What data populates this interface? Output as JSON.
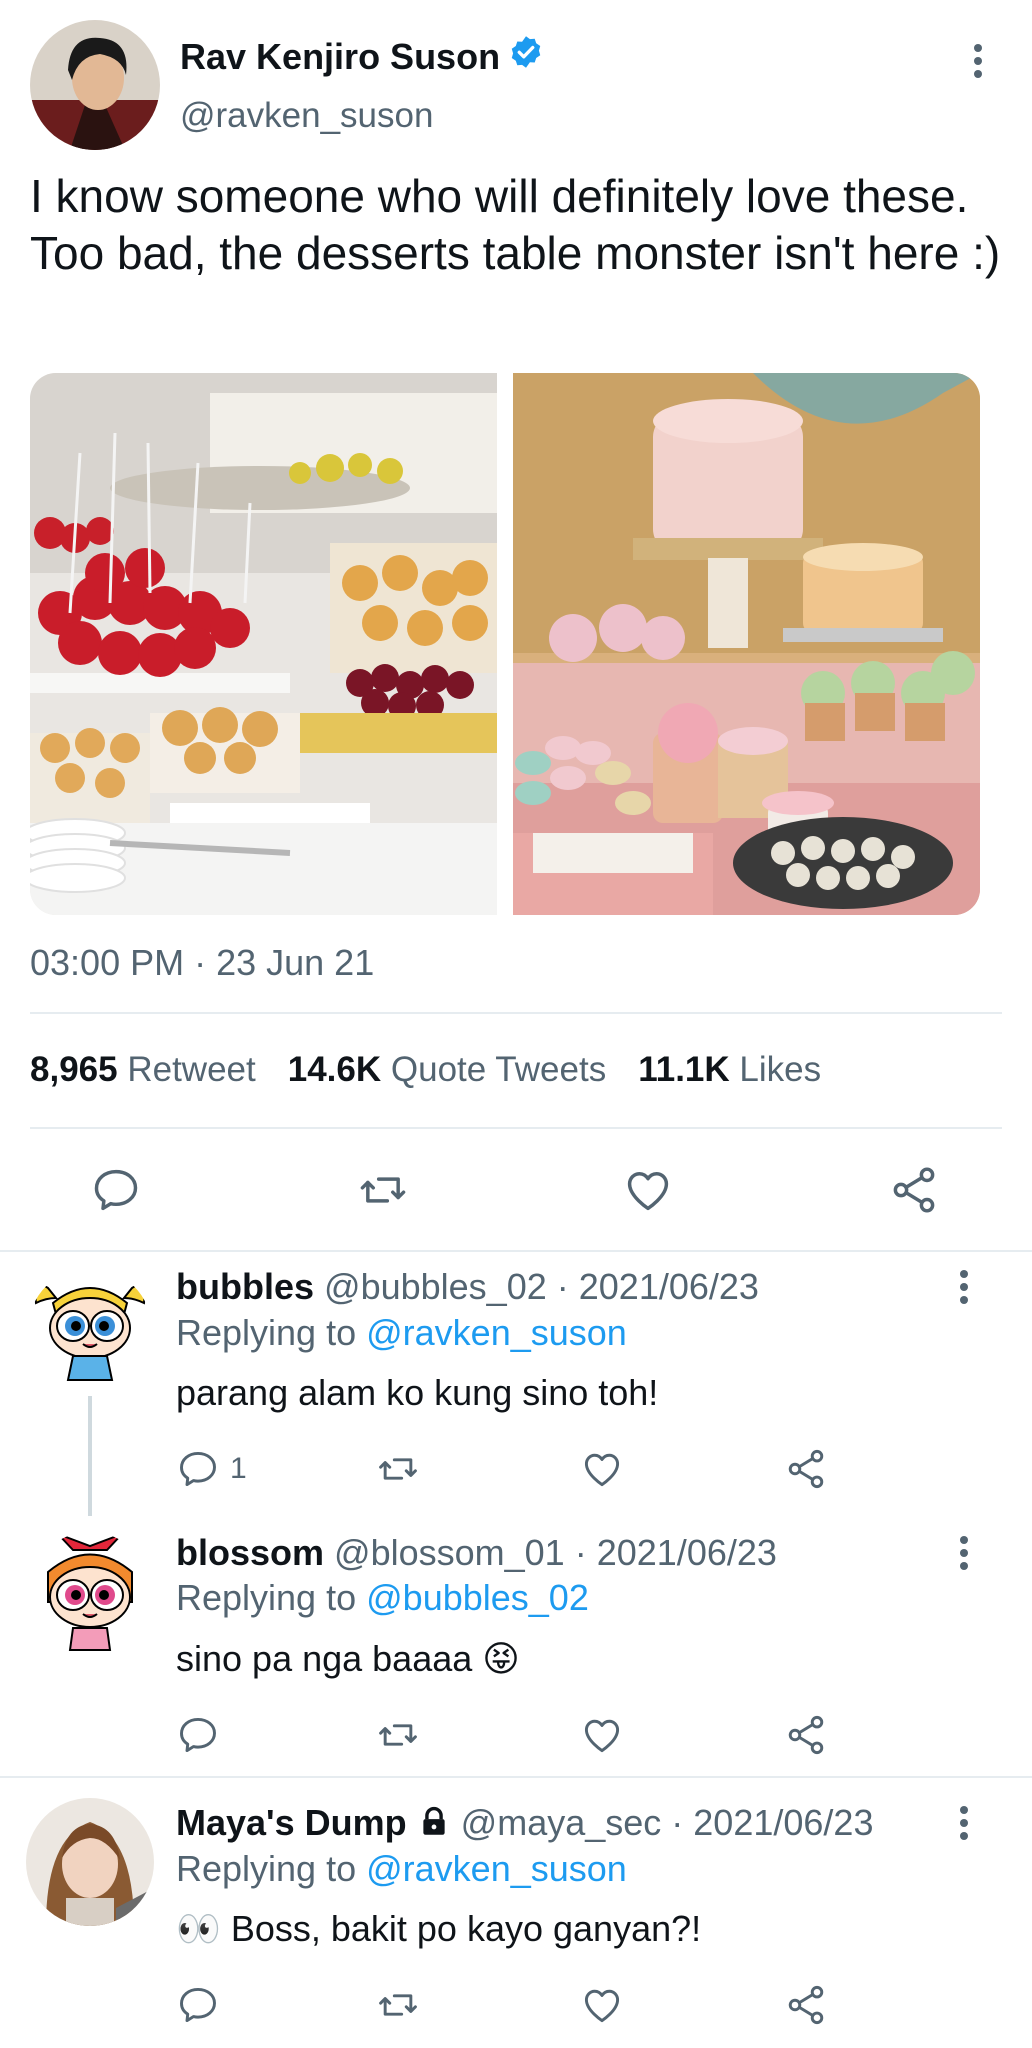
{
  "tweet": {
    "author_name": "Rav Kenjiro Suson",
    "author_handle": "@ravken_suson",
    "verified_icon": "verified-badge-icon",
    "text": "I know someone who will definitely love these. Too bad, the desserts table monster isn't here :)",
    "timestamp": "03:00 PM · 23 Jun 21",
    "stats": {
      "retweets_count": "8,965",
      "retweets_label": "Retweet",
      "quotes_count": "14.6K",
      "quotes_label": "Quote Tweets",
      "likes_count": "11.1K",
      "likes_label": "Likes"
    },
    "images": [
      "fruit-dessert-table-photo",
      "pink-cake-dessert-table-photo"
    ]
  },
  "replies": [
    {
      "name": "bubbles",
      "handle": "@bubbles_02",
      "date": "· 2021/06/23",
      "replying_label": "Replying to",
      "replying_to": "@ravken_suson",
      "text": "parang alam ko kung sino toh!",
      "reply_count": "1"
    },
    {
      "name": "blossom",
      "handle": "@blossom_01",
      "date": "· 2021/06/23",
      "replying_label": "Replying to",
      "replying_to": "@bubbles_02",
      "text": "sino pa nga baaaa 😝",
      "reply_count": ""
    },
    {
      "name": "Maya's Dump",
      "handle": "@maya_sec",
      "date": "· 2021/06/23",
      "replying_label": "Replying to",
      "replying_to": "@ravken_suson",
      "text": "👀 Boss, bakit po kayo ganyan?!",
      "reply_count": "",
      "lock_icon": "lock-icon"
    }
  ],
  "colors": {
    "accent": "#1d9bf0",
    "secondary_text": "#536471",
    "primary_text": "#0f1419",
    "divider": "#e6ecf0"
  }
}
